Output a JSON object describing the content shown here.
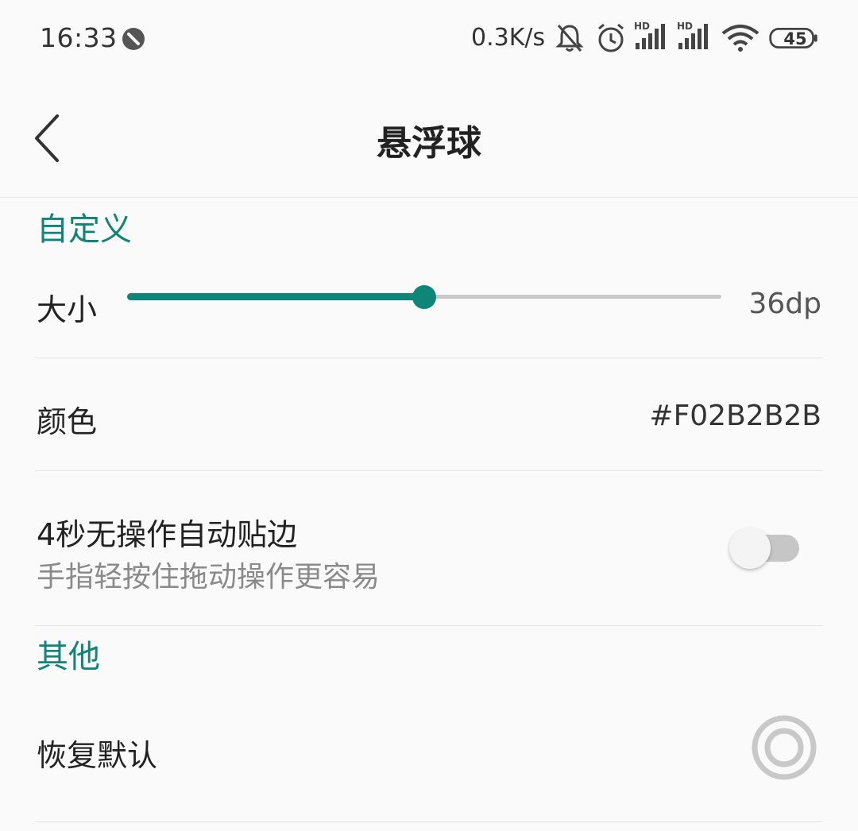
{
  "status_bar": {
    "time": "16:33",
    "network_speed": "0.3K/s",
    "signal1_label": "HD",
    "signal2_label": "HD",
    "battery": "45"
  },
  "header": {
    "title": "悬浮球"
  },
  "sections": {
    "custom": {
      "title": "自定义",
      "size": {
        "label": "大小",
        "value": "36dp",
        "slider_fraction": 0.5
      },
      "color": {
        "label": "颜色",
        "value": "#F02B2B2B"
      },
      "auto_edge": {
        "label": "4秒无操作自动贴边",
        "summary": "手指轻按住拖动操作更容易",
        "enabled": false
      }
    },
    "other": {
      "title": "其他",
      "restore": {
        "label": "恢复默认"
      }
    }
  },
  "colors": {
    "accent": "#0e8577",
    "background": "#fafafa",
    "track_off": "#c6c6c6"
  }
}
